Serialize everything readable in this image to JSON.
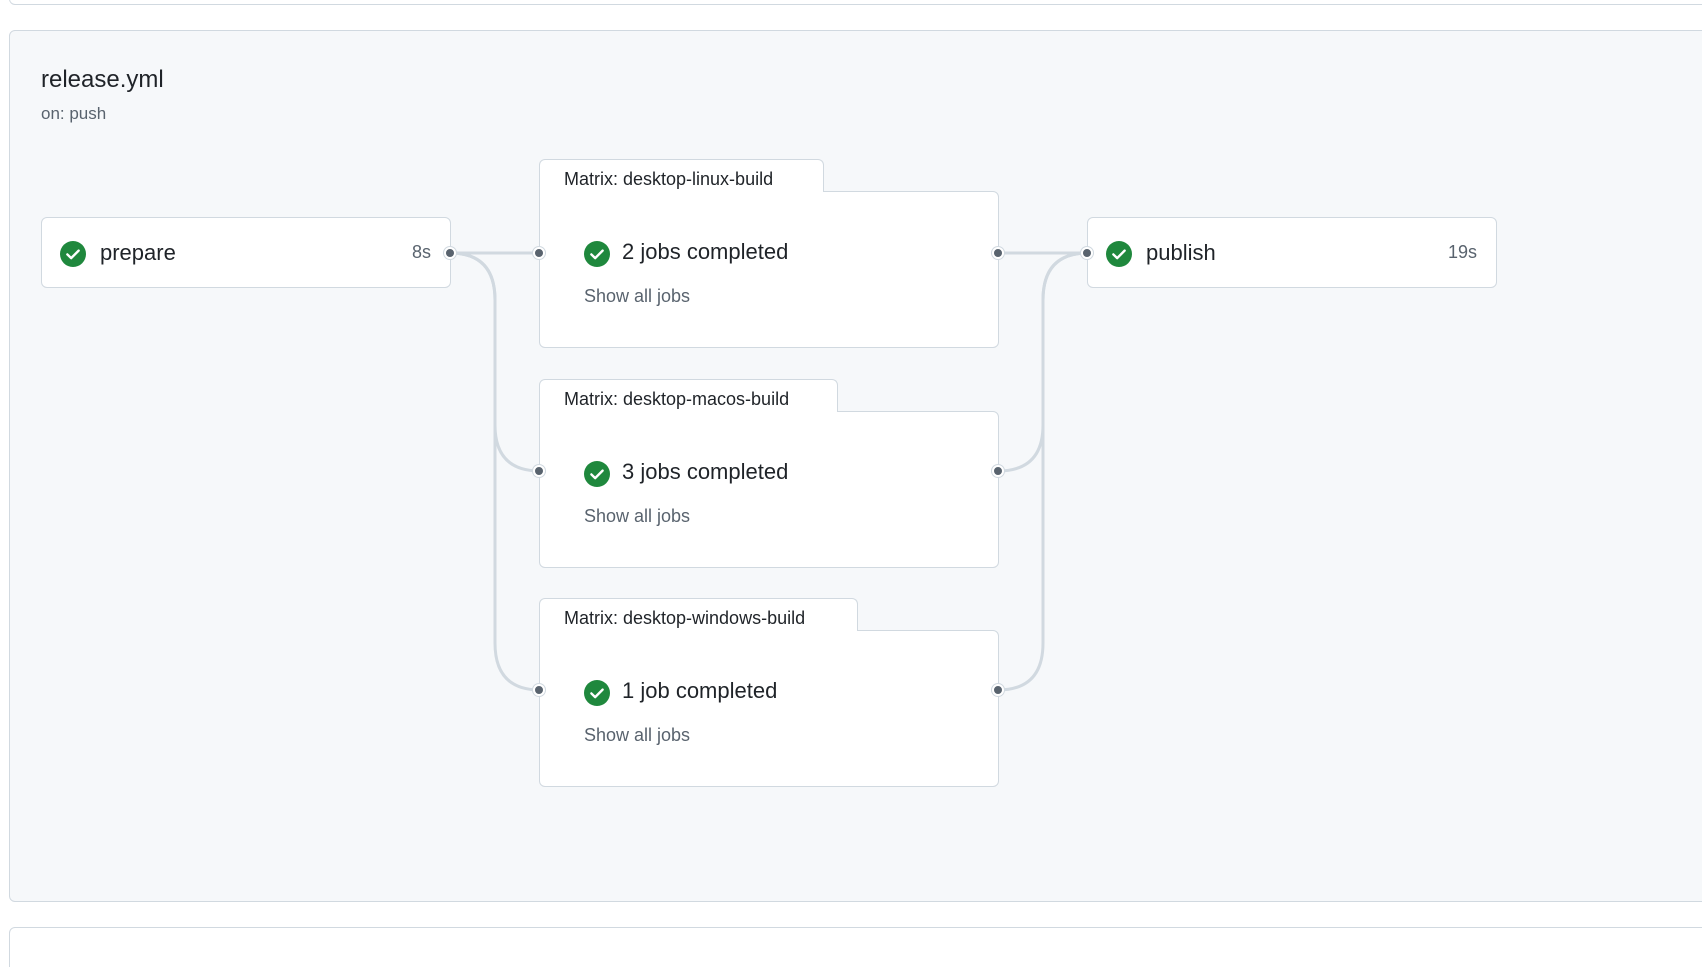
{
  "workflow": {
    "file_name": "release.yml",
    "trigger": "on: push"
  },
  "jobs": {
    "prepare": {
      "name": "prepare",
      "duration": "8s",
      "status": "success"
    },
    "publish": {
      "name": "publish",
      "duration": "19s",
      "status": "success"
    }
  },
  "matrices": [
    {
      "title": "Matrix: desktop-linux-build",
      "status_text": "2 jobs completed",
      "link": "Show all jobs",
      "status": "success"
    },
    {
      "title": "Matrix: desktop-macos-build",
      "status_text": "3 jobs completed",
      "link": "Show all jobs",
      "status": "success"
    },
    {
      "title": "Matrix: desktop-windows-build",
      "status_text": "1 job completed",
      "link": "Show all jobs",
      "status": "success"
    }
  ],
  "colors": {
    "success": "#1f883d",
    "connector": "#d1d9e0",
    "dot": "#59636e",
    "panel_bg": "#f6f8fa",
    "border": "#d1d9e0"
  },
  "icons": {
    "status": "check-circle-fill-icon"
  }
}
